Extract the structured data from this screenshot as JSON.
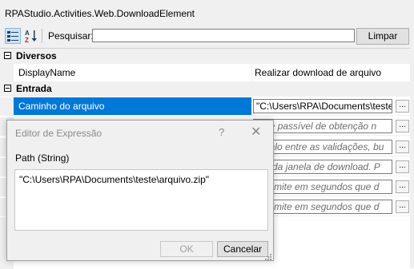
{
  "window": {
    "title": "RPAStudio.Activities.Web.DownloadElement"
  },
  "toolbar": {
    "categorized_icon": "categorized-view-icon",
    "alphabetical_icon": "sort-alphabetical-icon",
    "search_label": "Pesquisar:",
    "search_value": "",
    "clear_label": "Limpar"
  },
  "categories": [
    {
      "name": "Diversos"
    },
    {
      "name": "Entrada"
    }
  ],
  "properties": {
    "display_name": {
      "label": "DisplayName",
      "value": "Realizar download de arquivo"
    },
    "file_path": {
      "label": "Caminho do arquivo",
      "value": "\"C:\\Users\\RPA\\Documents\\teste"
    },
    "hints": [
      "ente passível de obtenção n",
      "ervalo entre as validações, bu",
      "me da janela de download. P",
      "po limite em segundos que d",
      "po limite em segundos que d"
    ],
    "ellipsis": "..."
  },
  "dialog": {
    "title": "Editor de Expressão",
    "help": "?",
    "close": "✕",
    "label": "Path (String)",
    "expression": "\"C:\\Users\\RPA\\Documents\\teste\\arquivo.zip\"",
    "ok_label": "OK",
    "cancel_label": "Cancelar"
  }
}
